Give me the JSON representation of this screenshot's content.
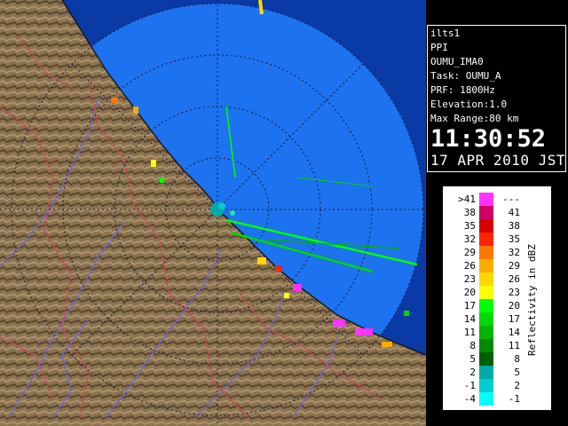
{
  "info": {
    "site": "ilts1",
    "scan_type": "PPI",
    "product": "OUMU_IMA0",
    "task": "Task: OUMU_A",
    "prf": "PRF: 1800Hz",
    "elevation": "Elevation:1.0",
    "max_range": "Max Range:80 km",
    "time": "11:30:52",
    "date": "17 APR 2010 JST"
  },
  "legend": {
    "title": "Reflectivity in dBZ",
    "rows": [
      {
        "lo": ">41",
        "hi": "---",
        "color": "#ff33ff"
      },
      {
        "lo": "38",
        "hi": "41",
        "color": "#cc0066"
      },
      {
        "lo": "35",
        "hi": "38",
        "color": "#d60000"
      },
      {
        "lo": "32",
        "hi": "35",
        "color": "#ff2200"
      },
      {
        "lo": "29",
        "hi": "32",
        "color": "#ff7700"
      },
      {
        "lo": "26",
        "hi": "29",
        "color": "#ffaa00"
      },
      {
        "lo": "23",
        "hi": "26",
        "color": "#ffd800"
      },
      {
        "lo": "20",
        "hi": "23",
        "color": "#ffff00"
      },
      {
        "lo": "17",
        "hi": "20",
        "color": "#00ff00"
      },
      {
        "lo": "14",
        "hi": "17",
        "color": "#00d800"
      },
      {
        "lo": "11",
        "hi": "14",
        "color": "#00b400"
      },
      {
        "lo": "8",
        "hi": "11",
        "color": "#008a00"
      },
      {
        "lo": "5",
        "hi": "8",
        "color": "#006000"
      },
      {
        "lo": "2",
        "hi": "5",
        "color": "#00aaaa"
      },
      {
        "lo": "-1",
        "hi": "2",
        "color": "#00cccc"
      },
      {
        "lo": "-4",
        "hi": "-1",
        "color": "#00ffff"
      }
    ]
  },
  "colors": {
    "sea": "#1c72ef",
    "outside_range": "#0a3aa6",
    "land": "#8b7350",
    "land_dark": "#4a3a22",
    "rivers": "#6b64e0",
    "boundaries": "#d04060",
    "range_rings": "#222244",
    "echo": "#00ff00"
  }
}
